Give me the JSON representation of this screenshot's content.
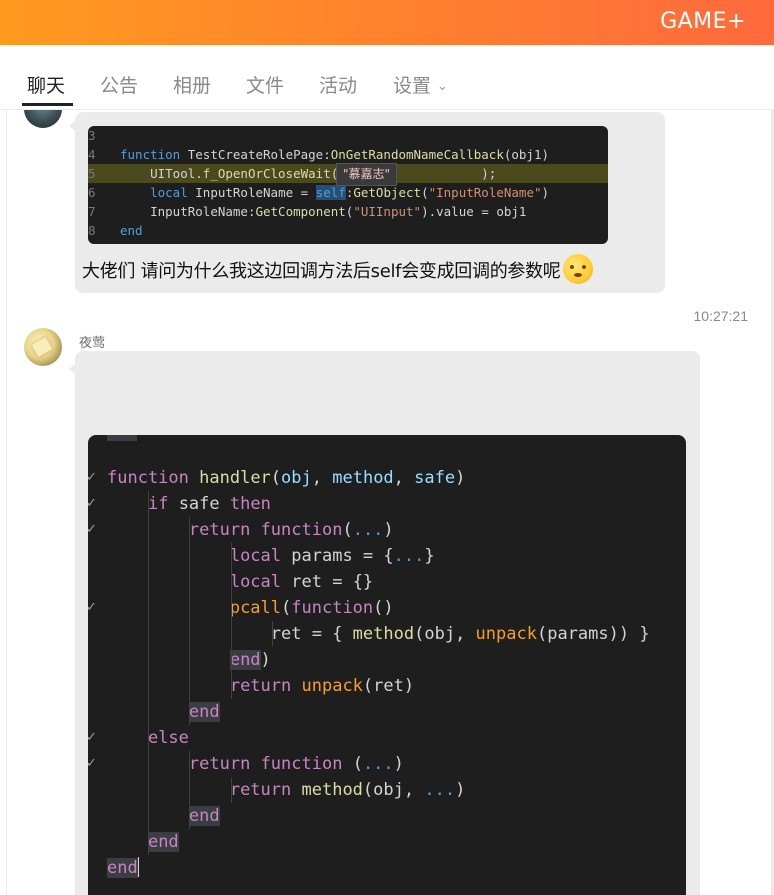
{
  "app": {
    "brand": "GAME+"
  },
  "tabs": [
    {
      "label": "聊天"
    },
    {
      "label": "公告"
    },
    {
      "label": "相册"
    },
    {
      "label": "文件"
    },
    {
      "label": "活动"
    },
    {
      "label": "设置"
    }
  ],
  "message1": {
    "code_lines": [
      {
        "n": "3",
        "text": ""
      },
      {
        "n": "4",
        "text": "function TestCreateRolePage:OnGetRandomNameCallback(obj1)"
      },
      {
        "n": "5",
        "text": "    UITool.f_OpenOrCloseWait(                   );"
      },
      {
        "n": "6",
        "text": "    local InputRoleName = self:GetObject(\"InputRoleName\")"
      },
      {
        "n": "7",
        "text": "    InputRoleName:GetComponent(\"UIInput\").value = obj1"
      },
      {
        "n": "8",
        "text": "end"
      }
    ],
    "tooltip": "\"慕嘉志\"",
    "text": "大佬们 请问为什么我这边回调方法后self会变成回调的参数呢"
  },
  "message2": {
    "timestamp": "10:27:21",
    "username": "夜莺",
    "code_lines": [
      "function handler(obj, method, safe)",
      "    if safe then",
      "        return function(...)",
      "            local params = {...}",
      "            local ret = {}",
      "            pcall(function()",
      "                ret = { method(obj, unpack(params)) }",
      "            end)",
      "            return unpack(ret)",
      "        end",
      "    else",
      "        return function (...)",
      "            return method(obj, ...)",
      "        end",
      "    end",
      "end"
    ]
  },
  "colors": {
    "accent": "#ff7f2e",
    "bubble": "#ebebeb",
    "code_bg": "#1e1e1e"
  }
}
